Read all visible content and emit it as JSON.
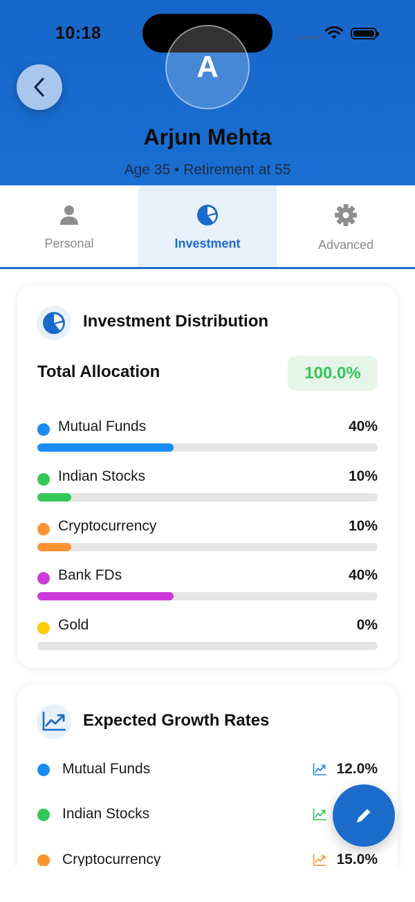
{
  "status": {
    "time": "10:18"
  },
  "profile": {
    "initial": "A",
    "name": "Arjun Mehta",
    "subtitle": "Age 35 • Retirement at 55"
  },
  "tabs": [
    {
      "label": "Personal",
      "icon": "person-icon",
      "active": false
    },
    {
      "label": "Investment",
      "icon": "pie-chart-icon",
      "active": true
    },
    {
      "label": "Advanced",
      "icon": "gear-icon",
      "active": false
    }
  ],
  "distribution": {
    "title": "Investment Distribution",
    "total_label": "Total Allocation",
    "total_value": "100.0%",
    "items": [
      {
        "label": "Mutual Funds",
        "pct": "40%",
        "fraction": 0.4,
        "color": "#1a8cf3"
      },
      {
        "label": "Indian Stocks",
        "pct": "10%",
        "fraction": 0.1,
        "color": "#34c759"
      },
      {
        "label": "Cryptocurrency",
        "pct": "10%",
        "fraction": 0.1,
        "color": "#ff9432"
      },
      {
        "label": "Bank FDs",
        "pct": "40%",
        "fraction": 0.4,
        "color": "#cc3bd8"
      },
      {
        "label": "Gold",
        "pct": "0%",
        "fraction": 0.0,
        "color": "#ffcc00"
      }
    ]
  },
  "growth": {
    "title": "Expected Growth Rates",
    "items": [
      {
        "label": "Mutual Funds",
        "rate": "12.0%",
        "color": "#1a8cf3"
      },
      {
        "label": "Indian Stocks",
        "rate": "",
        "color": "#34c759"
      },
      {
        "label": "Cryptocurrency",
        "rate": "15.0%",
        "color": "#ff9432"
      }
    ]
  },
  "colors": {
    "primary": "#1a6bcc",
    "success": "#34c759"
  }
}
